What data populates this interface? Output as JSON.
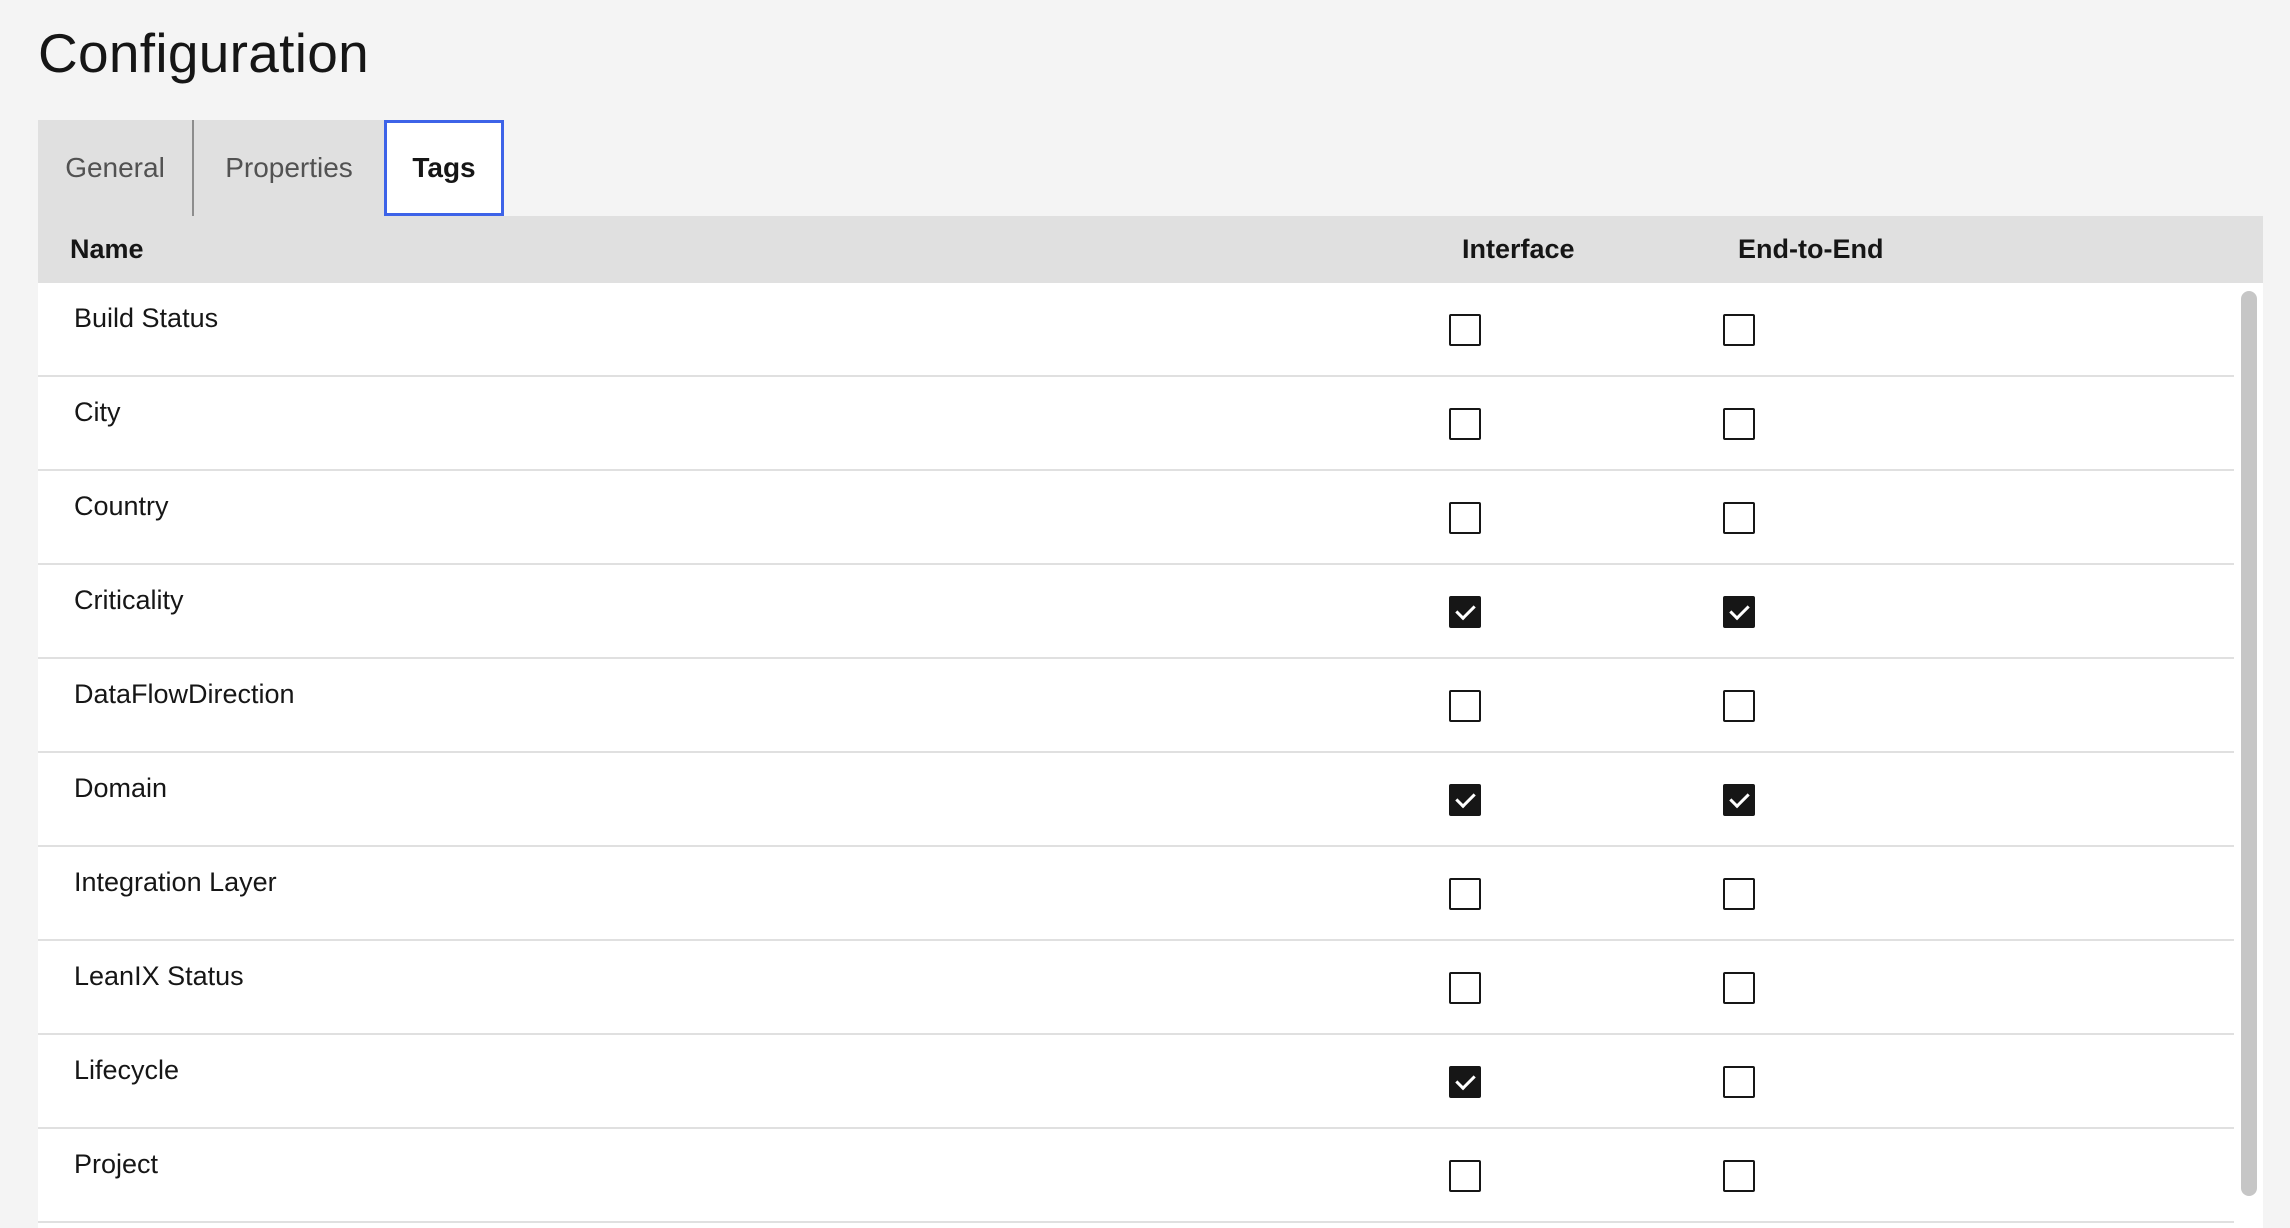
{
  "page": {
    "title": "Configuration"
  },
  "tabs": [
    {
      "label": "General",
      "selected": false
    },
    {
      "label": "Properties",
      "selected": false
    },
    {
      "label": "Tags",
      "selected": true
    }
  ],
  "table": {
    "columns": {
      "name": "Name",
      "interface": "Interface",
      "end_to_end": "End-to-End"
    },
    "rows": [
      {
        "name": "Build Status",
        "interface": false,
        "end_to_end": false
      },
      {
        "name": "City",
        "interface": false,
        "end_to_end": false
      },
      {
        "name": "Country",
        "interface": false,
        "end_to_end": false
      },
      {
        "name": "Criticality",
        "interface": true,
        "end_to_end": true
      },
      {
        "name": "DataFlowDirection",
        "interface": false,
        "end_to_end": false
      },
      {
        "name": "Domain",
        "interface": true,
        "end_to_end": true
      },
      {
        "name": "Integration Layer",
        "interface": false,
        "end_to_end": false
      },
      {
        "name": "LeanIX Status",
        "interface": false,
        "end_to_end": false
      },
      {
        "name": "Lifecycle",
        "interface": true,
        "end_to_end": false
      },
      {
        "name": "Project",
        "interface": false,
        "end_to_end": false
      }
    ]
  },
  "colors": {
    "accent": "#3d63e8",
    "header_bg": "#e0e0e0",
    "page_bg": "#f4f4f4",
    "checkbox": "#161616"
  }
}
